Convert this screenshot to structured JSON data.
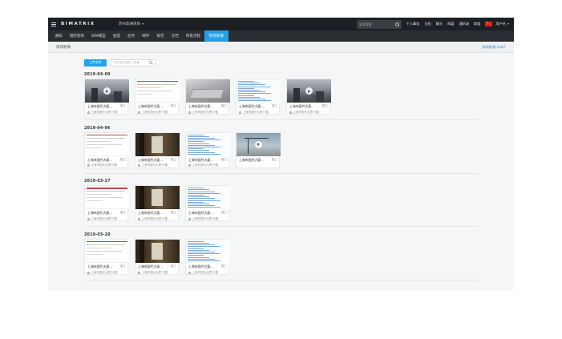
{
  "topbar": {
    "logo": "BIMATRIX",
    "project": "苏州李通项目",
    "search_placeholder": "全局搜索",
    "links": [
      "个人事务",
      "日程",
      "聊天",
      "网盘",
      "通讯录",
      "群组"
    ],
    "user": "用户名"
  },
  "nav": {
    "items": [
      "通知",
      "组织架构",
      "BIM模型",
      "进度",
      "任务",
      "邮件",
      "规范",
      "文档",
      "审批流程",
      "现场影像"
    ],
    "active_index": 9
  },
  "breadcrumb": {
    "title": "现场影像",
    "help": "现场影像 help?"
  },
  "toolbar": {
    "upload": "上传文件",
    "search_placeholder": "文件名/日期/上传者"
  },
  "groups": [
    {
      "date": "2019-04-09",
      "tiles": [
        {
          "thumb": "video",
          "name": "上海市园代大厦...",
          "tag": "施工",
          "owner": "上海市园代大厦79楼"
        },
        {
          "thumb": "doc",
          "name": "上海市园代大厦...",
          "tag": "施工",
          "owner": "上海市园代大厦79楼"
        },
        {
          "thumb": "laptop",
          "name": "上海市园代大厦...",
          "tag": "施工",
          "owner": "上海市园代大厦79楼"
        },
        {
          "thumb": "sheet",
          "name": "上海市园代大厦...",
          "tag": "施工",
          "owner": "上海市园代大厦79楼"
        },
        {
          "thumb": "video",
          "name": "上海市园代大厦...",
          "tag": "施工",
          "owner": "上海市园代大厦79楼"
        }
      ]
    },
    {
      "date": "2019-04-06",
      "tiles": [
        {
          "thumb": "doc",
          "name": "上海市园代大厦...",
          "tag": "施工",
          "owner": "上海市园代大厦79楼"
        },
        {
          "thumb": "photo",
          "name": "上海市园代大厦...",
          "tag": "施工",
          "owner": "上海市园代大厦79楼"
        },
        {
          "thumb": "sheet",
          "name": "上海市园代大厦...",
          "tag": "施工",
          "owner": "上海市园代大厦79楼"
        },
        {
          "thumb": "sky",
          "name": "上海市园代大厦...",
          "tag": "施工",
          "owner": ""
        }
      ]
    },
    {
      "date": "2019-03-27",
      "tiles": [
        {
          "thumb": "doc",
          "name": "上海市园代大厦...",
          "tag": "施工",
          "owner": "上海市园代大厦79楼"
        },
        {
          "thumb": "photo",
          "name": "上海市园代大厦...",
          "tag": "施工",
          "owner": "上海市园代大厦79楼"
        },
        {
          "thumb": "sheet",
          "name": "上海市园代大厦...",
          "tag": "施工",
          "owner": "上海市园代大厦79楼"
        }
      ]
    },
    {
      "date": "2019-03-20",
      "tiles": [
        {
          "thumb": "doc",
          "name": "上海市园代大厦...",
          "tag": "施工",
          "owner": "上海市园代大厦79楼"
        },
        {
          "thumb": "photo",
          "name": "上海市园代大厦...",
          "tag": "施工",
          "owner": "上海市园代大厦79楼"
        },
        {
          "thumb": "sheet",
          "name": "上海市园代大厦...",
          "tag": "施工",
          "owner": "上海市园代大厦79楼"
        }
      ]
    }
  ],
  "colors": {
    "accent": "#23a0e8",
    "topbar": "#1c1f24",
    "navbar": "#2a2d32"
  }
}
